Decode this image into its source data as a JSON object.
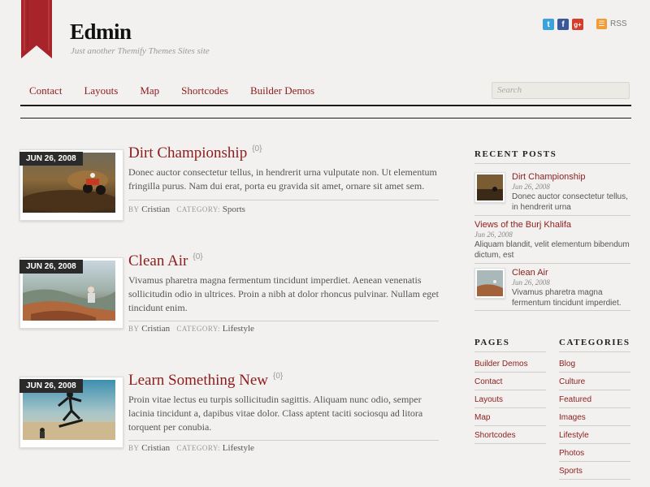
{
  "site": {
    "title": "Edmin",
    "tagline": "Just another Themify Themes Sites site"
  },
  "header": {
    "social": [
      {
        "icon": "twitter-icon",
        "glyph": "t"
      },
      {
        "icon": "facebook-icon",
        "glyph": "f"
      },
      {
        "icon": "google-plus-icon",
        "glyph": "g+"
      }
    ],
    "rss_label": "RSS"
  },
  "nav": {
    "items": [
      "Contact",
      "Layouts",
      "Map",
      "Shortcodes",
      "Builder Demos"
    ],
    "search_placeholder": "Search"
  },
  "posts": [
    {
      "date": "JUN 26, 2008",
      "title": "Dirt Championship",
      "comments": "0",
      "excerpt": "Donec auctor consectetur tellus, in hendrerit urna vulputate non. Ut elementum fringilla purus. Nam dui erat, porta eu gravida sit amet, ornare sit amet sem.",
      "by_label": "BY",
      "author": "Cristian",
      "category_label": "CATEGORY:",
      "category": "Sports"
    },
    {
      "date": "JUN 26, 2008",
      "title": "Clean Air",
      "comments": "0",
      "excerpt": "Vivamus pharetra magna fermentum tincidunt imperdiet. Aenean venenatis sollicitudin odio in ultrices. Proin a nibh at dolor rhoncus pulvinar. Nullam eget tincidunt enim.",
      "by_label": "BY",
      "author": "Cristian",
      "category_label": "CATEGORY:",
      "category": "Lifestyle"
    },
    {
      "date": "JUN 26, 2008",
      "title": "Learn Something New",
      "comments": "0",
      "excerpt": "Proin vitae lectus eu turpis sollicitudin sagittis. Aliquam nunc odio, semper lacinia tincidunt a, dapibus vitae dolor. Class aptent taciti sociosqu ad litora torquent per conubia.",
      "by_label": "BY",
      "author": "Cristian",
      "category_label": "CATEGORY:",
      "category": "Lifestyle"
    }
  ],
  "sidebar": {
    "recent_posts_heading": "RECENT POSTS",
    "recent_posts": [
      {
        "title": "Dirt Championship",
        "date": "Jun 26, 2008",
        "excerpt": "Donec auctor consectetur tellus, in hendrerit urna"
      },
      {
        "title": "Views of the Burj Khalifa",
        "date": "Jun 26, 2008",
        "excerpt": "Aliquam blandit, velit elementum bibendum dictum, est"
      },
      {
        "title": "Clean Air",
        "date": "Jun 26, 2008",
        "excerpt": "Vivamus pharetra magna fermentum tincidunt imperdiet."
      }
    ],
    "pages_heading": "PAGES",
    "pages": [
      "Builder Demos",
      "Contact",
      "Layouts",
      "Map",
      "Shortcodes"
    ],
    "categories_heading": "CATEGORIES",
    "categories": [
      "Blog",
      "Culture",
      "Featured",
      "Images",
      "Lifestyle",
      "Photos",
      "Sports"
    ]
  },
  "colors": {
    "accent": "#8c1d1d",
    "ribbon": "#a8242b",
    "background": "#f2f1ef"
  }
}
